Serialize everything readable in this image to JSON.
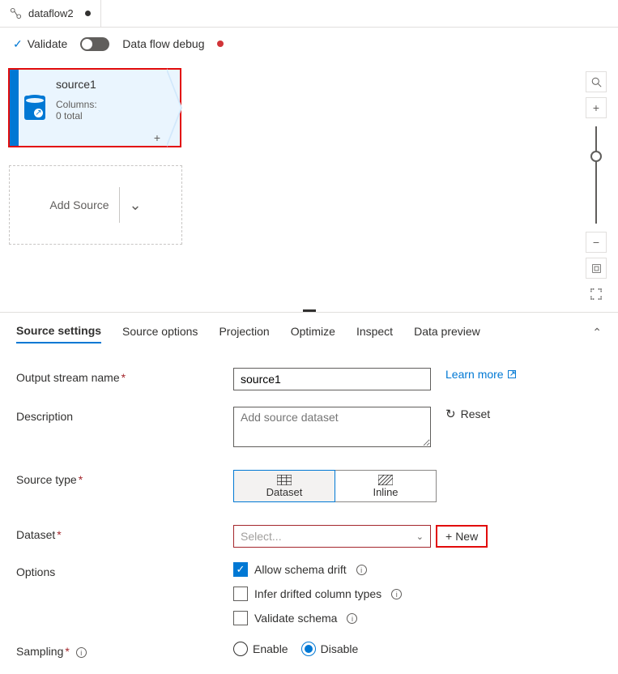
{
  "tab": {
    "name": "dataflow2"
  },
  "toolbar": {
    "validate": "Validate",
    "debug": "Data flow debug"
  },
  "canvas": {
    "source_node": {
      "title": "source1",
      "columns_label": "Columns:",
      "columns_count": "0 total"
    },
    "add_source": "Add Source"
  },
  "panel": {
    "tabs": [
      "Source settings",
      "Source options",
      "Projection",
      "Optimize",
      "Inspect",
      "Data preview"
    ],
    "output_stream": {
      "label": "Output stream name",
      "value": "source1",
      "learn_more": "Learn more"
    },
    "description": {
      "label": "Description",
      "placeholder": "Add source dataset",
      "reset": "Reset"
    },
    "source_type": {
      "label": "Source type",
      "options": [
        "Dataset",
        "Inline"
      ]
    },
    "dataset": {
      "label": "Dataset",
      "placeholder": "Select...",
      "new": "New"
    },
    "options": {
      "label": "Options",
      "allow_drift": "Allow schema drift",
      "infer_types": "Infer drifted column types",
      "validate_schema": "Validate schema"
    },
    "sampling": {
      "label": "Sampling",
      "enable": "Enable",
      "disable": "Disable"
    }
  }
}
